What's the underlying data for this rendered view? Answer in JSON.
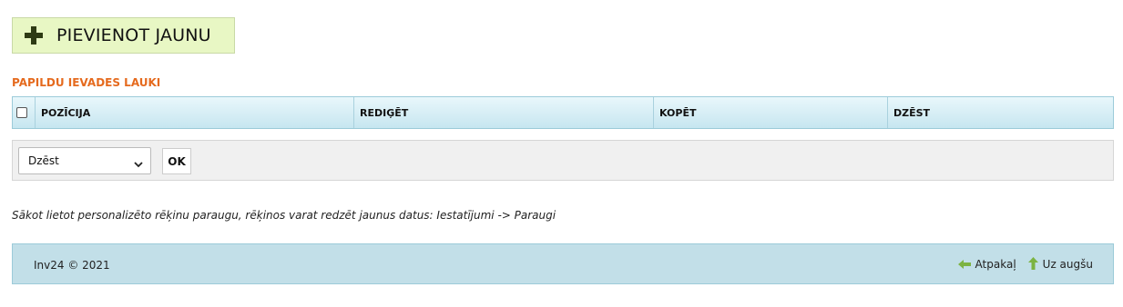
{
  "toolbar": {
    "add_label": "PIEVIENOT JAUNU"
  },
  "section": {
    "title": "PAPILDU IEVADES LAUKI"
  },
  "table": {
    "columns": [
      "POZĪCIJA",
      "REDIĢĒT",
      "KOPĒT",
      "DZĒST"
    ]
  },
  "bulk_action": {
    "selected": "Dzēst",
    "ok_label": "OK"
  },
  "info": {
    "text": "Sākot lietot personalizēto rēķinu paraugu, rēķinos varat redzēt jaunus datus: Iestatījumi -> Paraugi"
  },
  "footer": {
    "copyright": "Inv24 © 2021",
    "back_label": "Atpakaļ",
    "top_label": "Uz augšu"
  },
  "colors": {
    "accent_orange": "#e56a1e",
    "add_button_bg": "#e8f7c4",
    "header_blue": "#c6e6f0",
    "footer_bg": "#c2dfe8",
    "icon_green": "#7cb342"
  }
}
